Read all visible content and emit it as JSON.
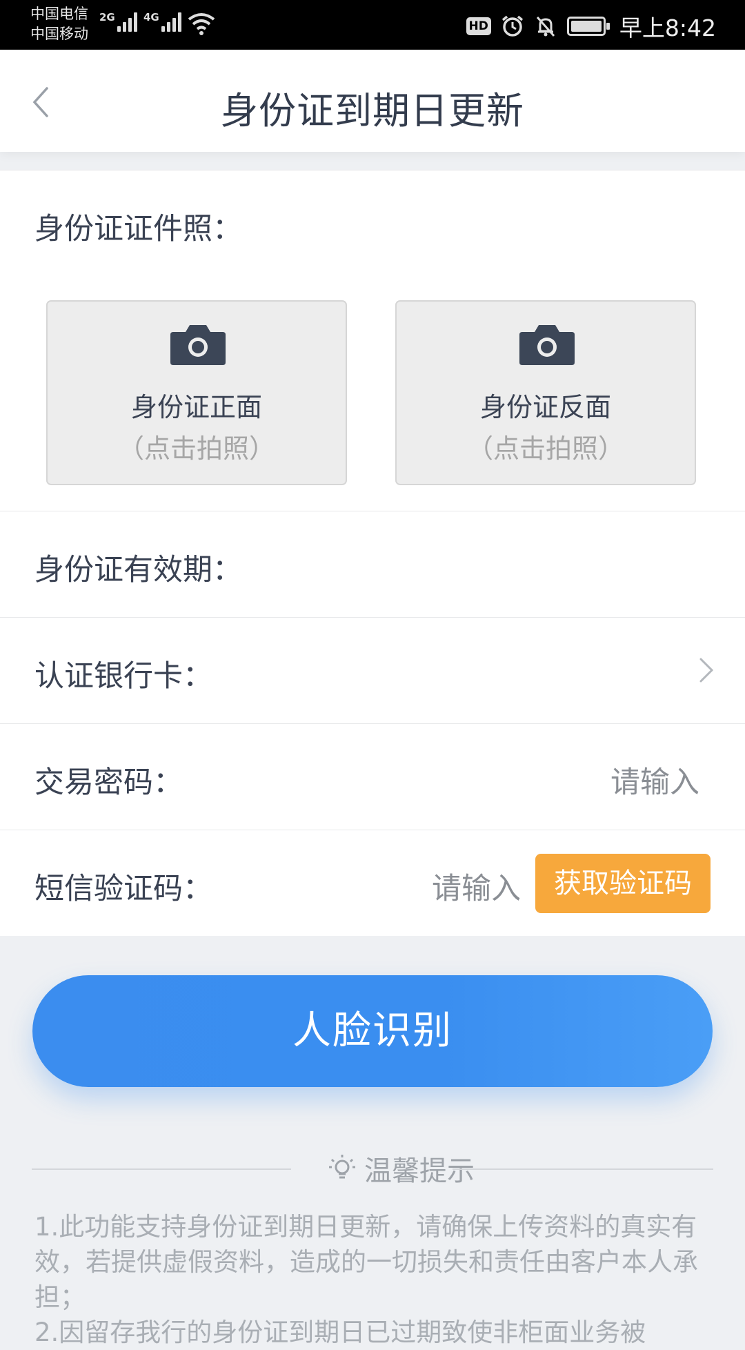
{
  "status_bar": {
    "carrier_1": "中国电信",
    "carrier_2": "中国移动",
    "signal_1_tag": "2G",
    "signal_2_tag": "4G",
    "hd_badge": "HD",
    "time": "早上8:42",
    "icons": [
      "signal-icon",
      "wifi-icon",
      "hd-icon",
      "alarm-icon",
      "mute-icon",
      "battery-icon"
    ]
  },
  "header": {
    "title": "身份证到期日更新",
    "back_icon": "chevron-left-icon"
  },
  "id_photos": {
    "label": "身份证证件照：",
    "front": {
      "title": "身份证正面",
      "hint": "（点击拍照）",
      "icon": "camera-icon"
    },
    "back": {
      "title": "身份证反面",
      "hint": "（点击拍照）",
      "icon": "camera-icon"
    }
  },
  "fields": {
    "validity": {
      "label": "身份证有效期："
    },
    "bank_card": {
      "label": "认证银行卡：",
      "icon": "chevron-right-icon"
    },
    "trade_password": {
      "label": "交易密码：",
      "placeholder": "请输入"
    },
    "sms_code": {
      "label": "短信验证码：",
      "placeholder": "请输入",
      "button": "获取验证码"
    }
  },
  "face_button": "人脸识别",
  "tips": {
    "title": "温馨提示",
    "icon": "lightbulb-icon",
    "lines": [
      "1.此功能支持身份证到期日更新，请确保上传资料的真实有效，若提供虚假资料，造成的一切损失和责任由客户本人承担；",
      "2.因留存我行的身份证到期日已过期致使非柜面业务被"
    ]
  },
  "colors": {
    "primary_blue": "#3a8ef0",
    "sms_orange": "#f7a83c",
    "text_dark": "#3a4253",
    "text_hint": "#a6a6a6",
    "page_bg": "#eef0f3"
  }
}
